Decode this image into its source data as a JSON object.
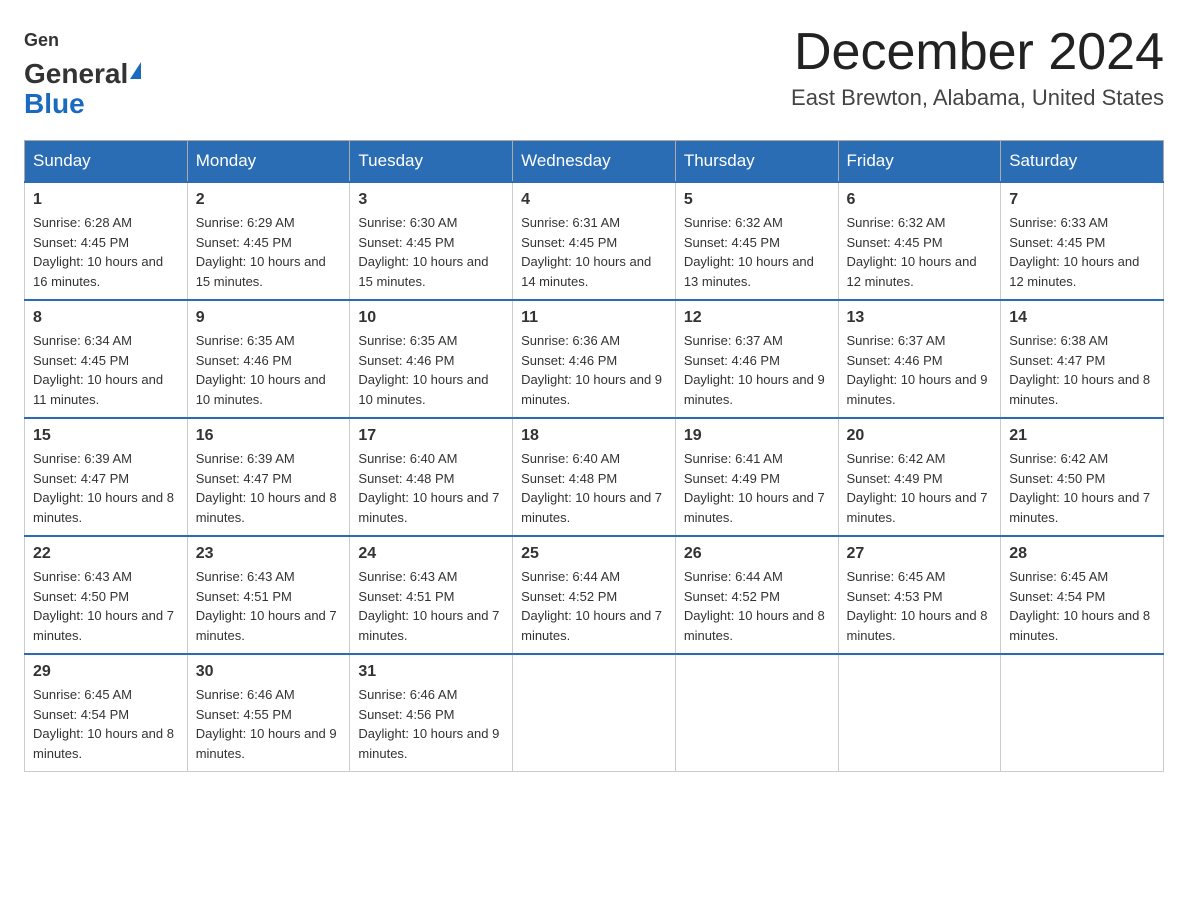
{
  "header": {
    "logo": {
      "general": "General",
      "blue": "Blue"
    },
    "month": "December 2024",
    "location": "East Brewton, Alabama, United States"
  },
  "weekdays": [
    "Sunday",
    "Monday",
    "Tuesday",
    "Wednesday",
    "Thursday",
    "Friday",
    "Saturday"
  ],
  "weeks": [
    [
      {
        "day": "1",
        "sunrise": "6:28 AM",
        "sunset": "4:45 PM",
        "daylight": "10 hours and 16 minutes."
      },
      {
        "day": "2",
        "sunrise": "6:29 AM",
        "sunset": "4:45 PM",
        "daylight": "10 hours and 15 minutes."
      },
      {
        "day": "3",
        "sunrise": "6:30 AM",
        "sunset": "4:45 PM",
        "daylight": "10 hours and 15 minutes."
      },
      {
        "day": "4",
        "sunrise": "6:31 AM",
        "sunset": "4:45 PM",
        "daylight": "10 hours and 14 minutes."
      },
      {
        "day": "5",
        "sunrise": "6:32 AM",
        "sunset": "4:45 PM",
        "daylight": "10 hours and 13 minutes."
      },
      {
        "day": "6",
        "sunrise": "6:32 AM",
        "sunset": "4:45 PM",
        "daylight": "10 hours and 12 minutes."
      },
      {
        "day": "7",
        "sunrise": "6:33 AM",
        "sunset": "4:45 PM",
        "daylight": "10 hours and 12 minutes."
      }
    ],
    [
      {
        "day": "8",
        "sunrise": "6:34 AM",
        "sunset": "4:45 PM",
        "daylight": "10 hours and 11 minutes."
      },
      {
        "day": "9",
        "sunrise": "6:35 AM",
        "sunset": "4:46 PM",
        "daylight": "10 hours and 10 minutes."
      },
      {
        "day": "10",
        "sunrise": "6:35 AM",
        "sunset": "4:46 PM",
        "daylight": "10 hours and 10 minutes."
      },
      {
        "day": "11",
        "sunrise": "6:36 AM",
        "sunset": "4:46 PM",
        "daylight": "10 hours and 9 minutes."
      },
      {
        "day": "12",
        "sunrise": "6:37 AM",
        "sunset": "4:46 PM",
        "daylight": "10 hours and 9 minutes."
      },
      {
        "day": "13",
        "sunrise": "6:37 AM",
        "sunset": "4:46 PM",
        "daylight": "10 hours and 9 minutes."
      },
      {
        "day": "14",
        "sunrise": "6:38 AM",
        "sunset": "4:47 PM",
        "daylight": "10 hours and 8 minutes."
      }
    ],
    [
      {
        "day": "15",
        "sunrise": "6:39 AM",
        "sunset": "4:47 PM",
        "daylight": "10 hours and 8 minutes."
      },
      {
        "day": "16",
        "sunrise": "6:39 AM",
        "sunset": "4:47 PM",
        "daylight": "10 hours and 8 minutes."
      },
      {
        "day": "17",
        "sunrise": "6:40 AM",
        "sunset": "4:48 PM",
        "daylight": "10 hours and 7 minutes."
      },
      {
        "day": "18",
        "sunrise": "6:40 AM",
        "sunset": "4:48 PM",
        "daylight": "10 hours and 7 minutes."
      },
      {
        "day": "19",
        "sunrise": "6:41 AM",
        "sunset": "4:49 PM",
        "daylight": "10 hours and 7 minutes."
      },
      {
        "day": "20",
        "sunrise": "6:42 AM",
        "sunset": "4:49 PM",
        "daylight": "10 hours and 7 minutes."
      },
      {
        "day": "21",
        "sunrise": "6:42 AM",
        "sunset": "4:50 PM",
        "daylight": "10 hours and 7 minutes."
      }
    ],
    [
      {
        "day": "22",
        "sunrise": "6:43 AM",
        "sunset": "4:50 PM",
        "daylight": "10 hours and 7 minutes."
      },
      {
        "day": "23",
        "sunrise": "6:43 AM",
        "sunset": "4:51 PM",
        "daylight": "10 hours and 7 minutes."
      },
      {
        "day": "24",
        "sunrise": "6:43 AM",
        "sunset": "4:51 PM",
        "daylight": "10 hours and 7 minutes."
      },
      {
        "day": "25",
        "sunrise": "6:44 AM",
        "sunset": "4:52 PM",
        "daylight": "10 hours and 7 minutes."
      },
      {
        "day": "26",
        "sunrise": "6:44 AM",
        "sunset": "4:52 PM",
        "daylight": "10 hours and 8 minutes."
      },
      {
        "day": "27",
        "sunrise": "6:45 AM",
        "sunset": "4:53 PM",
        "daylight": "10 hours and 8 minutes."
      },
      {
        "day": "28",
        "sunrise": "6:45 AM",
        "sunset": "4:54 PM",
        "daylight": "10 hours and 8 minutes."
      }
    ],
    [
      {
        "day": "29",
        "sunrise": "6:45 AM",
        "sunset": "4:54 PM",
        "daylight": "10 hours and 8 minutes."
      },
      {
        "day": "30",
        "sunrise": "6:46 AM",
        "sunset": "4:55 PM",
        "daylight": "10 hours and 9 minutes."
      },
      {
        "day": "31",
        "sunrise": "6:46 AM",
        "sunset": "4:56 PM",
        "daylight": "10 hours and 9 minutes."
      },
      null,
      null,
      null,
      null
    ]
  ],
  "labels": {
    "sunrise": "Sunrise:",
    "sunset": "Sunset:",
    "daylight": "Daylight:"
  }
}
